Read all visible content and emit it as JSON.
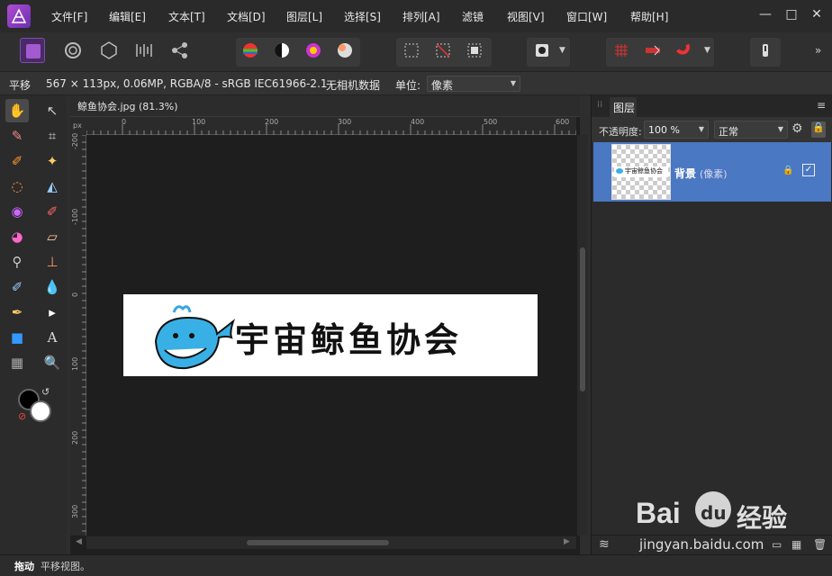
{
  "menubar": {
    "items": [
      "文件[F]",
      "编辑[E]",
      "文本[T]",
      "文档[D]",
      "图层[L]",
      "选择[S]",
      "排列[A]",
      "滤镜",
      "视图[V]",
      "窗口[W]",
      "帮助[H]"
    ]
  },
  "context_bar": {
    "tool_name": "平移",
    "image_info": "567 × 113px, 0.06MP, RGBA/8 - sRGB IEC61966-2.1",
    "camera_data": "无相机数据",
    "units_label": "单位:",
    "units_value": "像素"
  },
  "document": {
    "tab_title": "鲸鱼协会.jpg (81.3%)",
    "ruler_unit": "px",
    "h_ticks": [
      "0",
      "100",
      "200",
      "300",
      "400",
      "500",
      "600"
    ],
    "v_ticks": [
      "-200",
      "-100",
      "0",
      "100",
      "200",
      "300"
    ],
    "image_text": "宇宙鲸鱼协会"
  },
  "layers_panel": {
    "tab_title": "图层",
    "opacity_label": "不透明度:",
    "opacity_value": "100 %",
    "blend_mode": "正常",
    "layer_name": "背景",
    "layer_type": "(像素)",
    "thumb_text": "宇宙鲸鱼协会"
  },
  "status": {
    "tool": "拖动",
    "hint": "平移视图。"
  },
  "watermark": {
    "brand": "Bai",
    "brand2": "du",
    "cn": "经验",
    "url": "jingyan.baidu.com"
  },
  "colors": {
    "accent_layer": "#4a78c2",
    "app_logo": "#9b45c9"
  }
}
